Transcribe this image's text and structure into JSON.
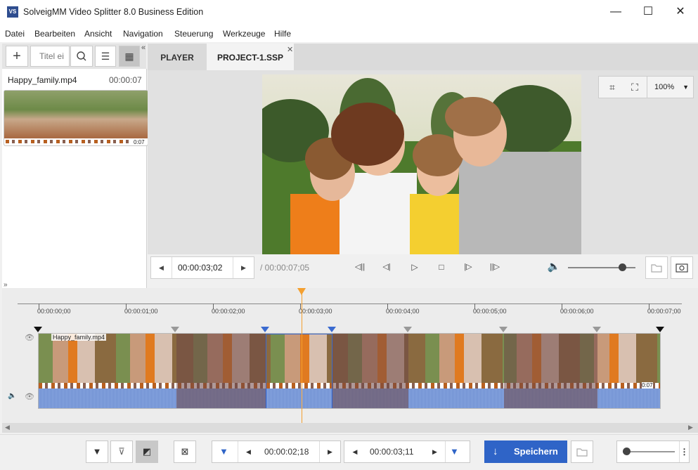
{
  "app": {
    "title": "SolveigMM Video Splitter 8.0 Business Edition",
    "icon_text": "VS"
  },
  "window": {
    "min": "—",
    "max": "☐",
    "close": "✕"
  },
  "menu": [
    "Datei",
    "Bearbeiten",
    "Ansicht",
    "Navigation",
    "Steuerung",
    "Werkzeuge",
    "Hilfe"
  ],
  "sidebar": {
    "search_placeholder": "Titel ei",
    "file": {
      "name": "Happy_family.mp4",
      "duration": "00:00:07",
      "thumb_duration": "0:07"
    }
  },
  "tabs": [
    {
      "label": "PLAYER"
    },
    {
      "label": "PROJECT-1.SSP"
    }
  ],
  "player": {
    "zoom": "100%",
    "current_time": "00:00:03;02",
    "total_time": "/ 00:00:07;05",
    "volume_level": 0.8
  },
  "timeline": {
    "ruler_labels": [
      "00:00:00;00",
      "00:00:01;00",
      "00:00:02;00",
      "00:00:03;00",
      "00:00:04;00",
      "00:00:05;00",
      "00:00:06;00",
      "00:00:07;00"
    ],
    "clip_name": "Happy_family.mp4",
    "clip_duration": "0:07",
    "playhead_time_sec": 3.02
  },
  "bottom": {
    "start_time": "00:00:02;18",
    "end_time": "00:00:03;11",
    "save_label": "Speichern"
  },
  "colors": {
    "accent": "#2f64c7",
    "playhead": "#f4a030",
    "excluded": "#8a6a6a"
  }
}
